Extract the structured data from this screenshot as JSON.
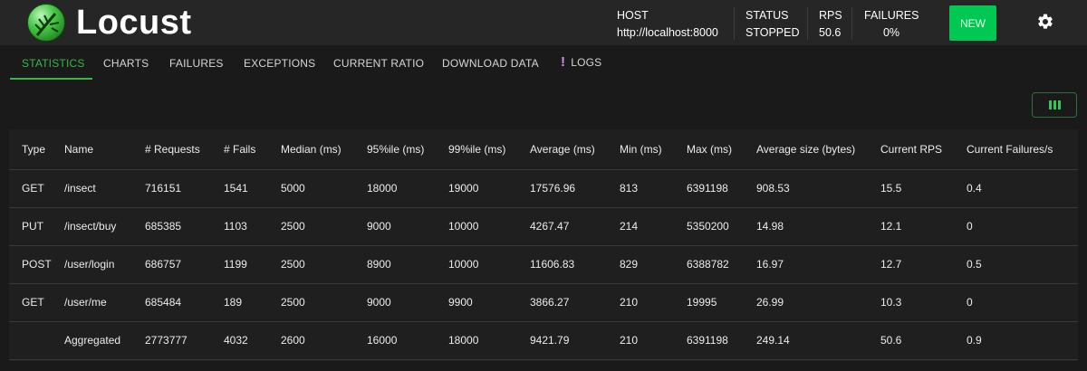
{
  "header": {
    "brand": "Locust",
    "host_label": "HOST",
    "host_value": "http://localhost:8000",
    "status_label": "STATUS",
    "status_value": "STOPPED",
    "rps_label": "RPS",
    "rps_value": "50.6",
    "failures_label": "FAILURES",
    "failures_value": "0%",
    "new_button": "NEW",
    "settings_icon": "gear-icon"
  },
  "tabs": [
    {
      "label": "STATISTICS",
      "active": true
    },
    {
      "label": "CHARTS"
    },
    {
      "label": "FAILURES"
    },
    {
      "label": "EXCEPTIONS"
    },
    {
      "label": "CURRENT RATIO"
    },
    {
      "label": "DOWNLOAD DATA"
    },
    {
      "label": "LOGS",
      "icon": "!"
    }
  ],
  "column_toggle_icon": "columns-icon",
  "colors": {
    "accent_green": "#3ab54a",
    "new_button": "#00c853",
    "logs_badge": "#d58cf0"
  },
  "table": {
    "columns": [
      "Type",
      "Name",
      "# Requests",
      "# Fails",
      "Median (ms)",
      "95%ile (ms)",
      "99%ile (ms)",
      "Average (ms)",
      "Min (ms)",
      "Max (ms)",
      "Average size (bytes)",
      "Current RPS",
      "Current Failures/s"
    ],
    "rows": [
      [
        "GET",
        "/insect",
        "716151",
        "1541",
        "5000",
        "18000",
        "19000",
        "17576.96",
        "813",
        "6391198",
        "908.53",
        "15.5",
        "0.4"
      ],
      [
        "PUT",
        "/insect/buy",
        "685385",
        "1103",
        "2500",
        "9000",
        "10000",
        "4267.47",
        "214",
        "5350200",
        "14.98",
        "12.1",
        "0"
      ],
      [
        "POST",
        "/user/login",
        "686757",
        "1199",
        "2500",
        "8900",
        "10000",
        "11606.83",
        "829",
        "6388782",
        "16.97",
        "12.7",
        "0.5"
      ],
      [
        "GET",
        "/user/me",
        "685484",
        "189",
        "2500",
        "9000",
        "9900",
        "3866.27",
        "210",
        "19995",
        "26.99",
        "10.3",
        "0"
      ],
      [
        "",
        "Aggregated",
        "2773777",
        "4032",
        "2600",
        "16000",
        "18000",
        "9421.79",
        "210",
        "6391198",
        "249.14",
        "50.6",
        "0.9"
      ]
    ]
  }
}
